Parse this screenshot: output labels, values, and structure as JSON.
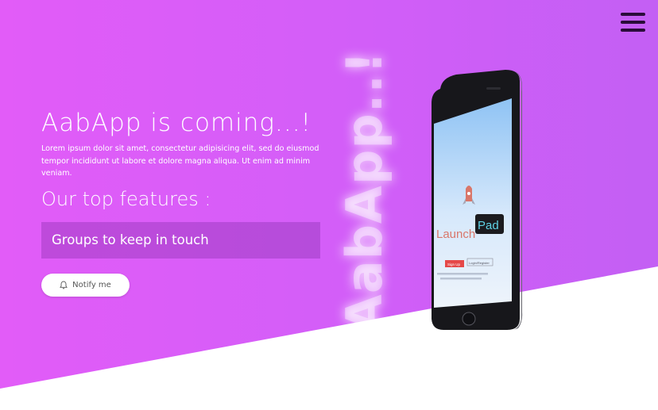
{
  "hero": {
    "title": "AabApp is coming...!",
    "description": "Lorem ipsum dolor sit amet, consectetur adipisicing elit, sed do eiusmod tempor incididunt ut labore et dolore magna aliqua. Ut enim ad minim veniam.",
    "features_heading": "Our top features :",
    "feature_item": "Groups to keep in touch",
    "notify_label": "Notify me",
    "vertical_text": "AabApp..!"
  },
  "phone": {
    "app_name_part1": "Launch",
    "app_name_part2": "Pad",
    "sign_up": "Sign Up",
    "login": "Login/Register"
  },
  "colors": {
    "gradient_start": "#e25cf8",
    "gradient_end": "#c35ff4",
    "menu_icon": "#2a0c3a",
    "background": "#ffffff"
  },
  "icons": {
    "menu": "hamburger-menu-icon",
    "notify": "bell-icon",
    "app_logo": "rocket-icon"
  }
}
